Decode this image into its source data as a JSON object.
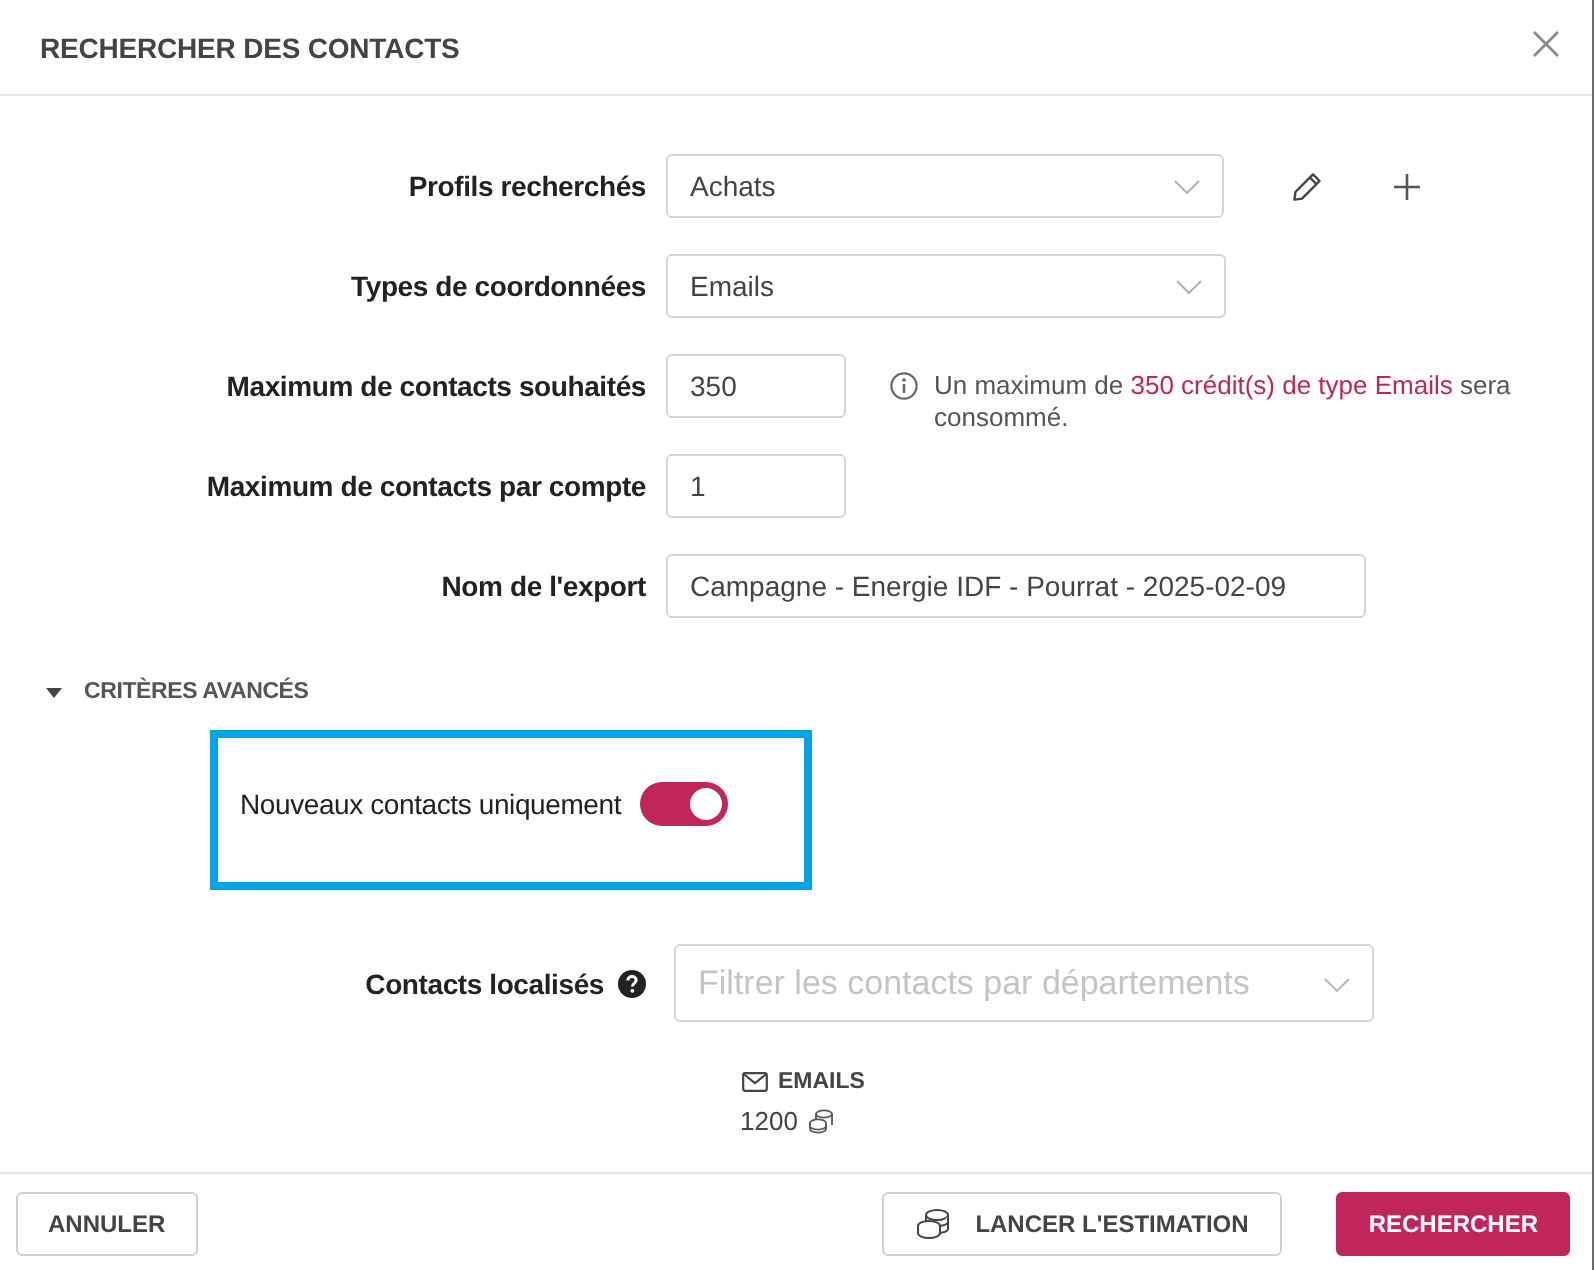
{
  "dialog": {
    "title": "RECHERCHER DES CONTACTS"
  },
  "fields": [
    {
      "kind": "profile",
      "label": "Profils recherchés",
      "value": "Achats"
    },
    {
      "kind": "select",
      "label": "Types de coordonnées",
      "value": "Emails"
    },
    {
      "kind": "number",
      "label": "Maximum de contacts souhaités",
      "value": "350",
      "hint": "Un maximum de **350 crédit(s) de type Emails** sera consommé."
    },
    {
      "kind": "number",
      "label": "Maximum de contacts par compte",
      "value": "1"
    },
    {
      "kind": "text",
      "label": "Nom de l'export",
      "value": "Campagne - Energie IDF - Pourrat - 2025-02-09"
    }
  ],
  "advanced": {
    "title": "CRITÈRES AVANCÉS",
    "expanded": true,
    "toggle": {
      "label": "Nouveaux contacts uniquement",
      "on": true,
      "highlighted": true
    },
    "location": {
      "label": "Contacts localisés",
      "placeholder": "Filtrer les contacts par départements"
    }
  },
  "summary": {
    "title": "EMAILS",
    "count": "1200"
  },
  "buttons": [
    {
      "kind": "secondary",
      "label": "ANNULER"
    },
    {
      "kind": "estimate",
      "label": "LANCER L'ESTIMATION"
    },
    {
      "kind": "primary",
      "label": "RECHERCHER"
    }
  ]
}
